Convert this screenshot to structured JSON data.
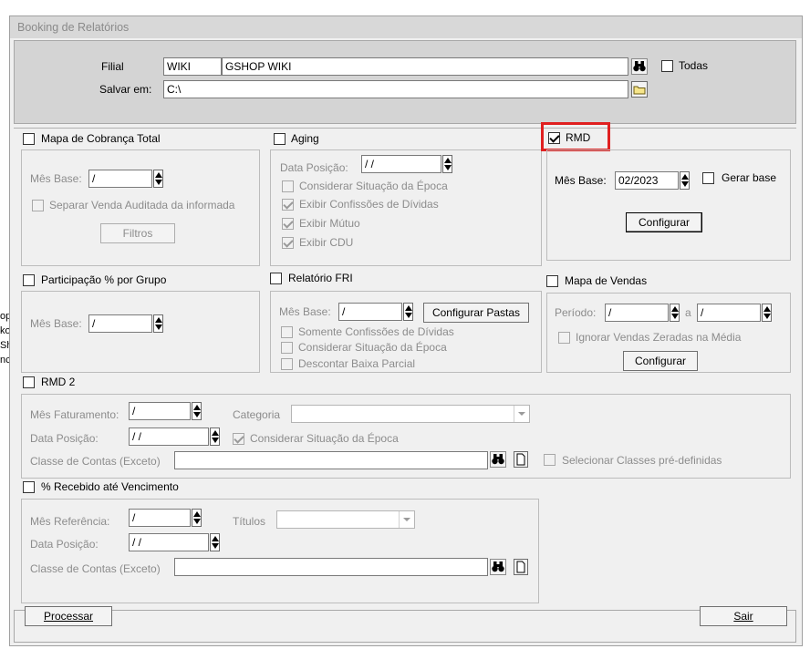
{
  "window": {
    "title": "Booking de Relatórios"
  },
  "header": {
    "filial_label": "Filial",
    "filial_code": "WIKI",
    "filial_name": "GSHOP WIKI",
    "todas_label": "Todas",
    "salvar_label": "Salvar em:",
    "salvar_path": "C:\\"
  },
  "mapa_cobranca": {
    "title": "Mapa de Cobrança Total",
    "mes_base_label": "Mês Base:",
    "mes_base_value": " /",
    "separar_label": "Separar Venda Auditada da informada",
    "filtros_label": "Filtros"
  },
  "aging": {
    "title": "Aging",
    "data_posicao_label": "Data Posição:",
    "data_posicao_value": " / /",
    "opt1": "Considerar Situação da Época",
    "opt2": "Exibir Confissões de Dívidas",
    "opt3": "Exibir Mútuo",
    "opt4": "Exibir CDU"
  },
  "rmd": {
    "title": "RMD",
    "mes_base_label": "Mês Base:",
    "mes_base_value": "02/2023",
    "gerar_base_label": "Gerar base",
    "configurar_label": "Configurar"
  },
  "participacao": {
    "title": "Participação % por Grupo",
    "mes_base_label": "Mês Base:",
    "mes_base_value": " /"
  },
  "fri": {
    "title": "Relatório FRI",
    "mes_base_label": "Mês Base:",
    "mes_base_value": " /",
    "configurar_pastas_label": "Configurar Pastas",
    "opt1": "Somente Confissões de Dívidas",
    "opt2": "Considerar Situação da Época",
    "opt3": "Descontar Baixa Parcial"
  },
  "mapa_vendas": {
    "title": "Mapa de Vendas",
    "periodo_label": "Período:",
    "periodo_from": " /",
    "a_label": "a",
    "periodo_to": " /",
    "ignorar_label": "Ignorar Vendas Zeradas na Média",
    "configurar_label": "Configurar"
  },
  "rmd2": {
    "title": "RMD 2",
    "mes_faturamento_label": "Mês Faturamento:",
    "mes_faturamento_value": " /",
    "categoria_label": "Categoria",
    "data_posicao_label": "Data Posição:",
    "data_posicao_value": " / /",
    "considerar_label": "Considerar Situação da Época",
    "classe_label": "Classe de Contas (Exceto)",
    "selecionar_label": "Selecionar Classes pré-definidas"
  },
  "recebido": {
    "title": "% Recebido até Vencimento",
    "mes_ref_label": "Mês Referência:",
    "mes_ref_value": " /",
    "titulos_label": "Títulos",
    "data_posicao_label": "Data Posição:",
    "data_posicao_value": " / /",
    "classe_label": "Classe de Contas (Exceto)"
  },
  "footer": {
    "processar_label": "Processar",
    "sair_label": "Sair"
  },
  "side_fragments": [
    "op",
    "ko",
    "Sh",
    "nc"
  ],
  "icons": {
    "binoculars": "binoculars-icon",
    "folder": "folder-icon",
    "document": "document-icon"
  },
  "colors": {
    "highlight": "#e02020",
    "window_bg": "#f0f0f0"
  }
}
